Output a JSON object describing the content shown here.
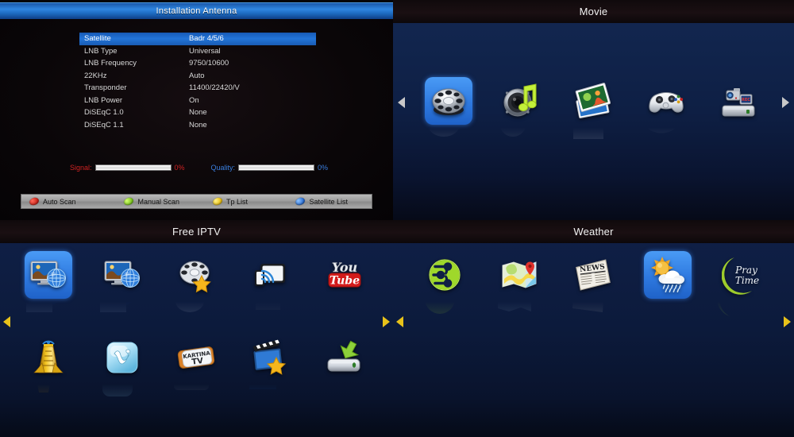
{
  "antenna": {
    "title": "Installation Antenna",
    "rows": [
      {
        "label": "Satellite",
        "value": "Badr 4/5/6",
        "selected": true
      },
      {
        "label": "LNB Type",
        "value": "Universal",
        "selected": false
      },
      {
        "label": "LNB Frequency",
        "value": "9750/10600",
        "selected": false
      },
      {
        "label": "22KHz",
        "value": "Auto",
        "selected": false
      },
      {
        "label": "Transponder",
        "value": "11400/22420/V",
        "selected": false
      },
      {
        "label": "LNB Power",
        "value": "On",
        "selected": false
      },
      {
        "label": "DiSEqC 1.0",
        "value": "None",
        "selected": false
      },
      {
        "label": "DiSEqC 1.1",
        "value": "None",
        "selected": false
      }
    ],
    "meters": {
      "signal_label": "Signal:",
      "signal_value": "0%",
      "signal_percent": 0,
      "signal_color": "#cf2222",
      "quality_label": "Quality:",
      "quality_value": "0%",
      "quality_percent": 0,
      "quality_color": "#3a7fe0"
    },
    "keys": [
      {
        "color": "red",
        "hex": "#c51b12",
        "label": "Auto Scan"
      },
      {
        "color": "green",
        "hex": "#6fbf13",
        "label": "Manual Scan"
      },
      {
        "color": "yellow",
        "hex": "#e9b903",
        "label": "Tp List"
      },
      {
        "color": "blue",
        "hex": "#1d63cf",
        "label": "Satellite List"
      }
    ]
  },
  "movie": {
    "title": "Movie",
    "arrow_left": "◀",
    "arrow_right": "▶",
    "arrow_color": "#c8c8c8",
    "items": [
      {
        "icon": "film-reel-icon",
        "selected": true
      },
      {
        "icon": "music-speaker-icon",
        "selected": false
      },
      {
        "icon": "photo-gallery-icon",
        "selected": false
      },
      {
        "icon": "game-controller-icon",
        "selected": false
      },
      {
        "icon": "camcorder-pvr-icon",
        "selected": false
      }
    ]
  },
  "iptv": {
    "title": "Free IPTV",
    "arrow_left": "◀",
    "arrow_right": "▶",
    "arrow_color": "#e8c21a",
    "row1": [
      {
        "icon": "internet-tv-icon",
        "selected": true
      },
      {
        "icon": "internet-tv-alt-icon",
        "selected": false
      },
      {
        "icon": "film-reel-star-icon",
        "selected": false
      },
      {
        "icon": "screen-cast-icon",
        "selected": false
      },
      {
        "icon": "youtube-icon",
        "selected": false,
        "text_top": "You",
        "text_bottom": "Tube"
      }
    ],
    "row2": [
      {
        "icon": "broadcast-tower-icon",
        "selected": false
      },
      {
        "icon": "vimeo-ice-icon",
        "selected": false
      },
      {
        "icon": "kartina-tv-icon",
        "selected": false,
        "text_top": "KARTINA",
        "text_bottom": "TV"
      },
      {
        "icon": "clapperboard-star-icon",
        "selected": false
      },
      {
        "icon": "download-drive-icon",
        "selected": false
      }
    ]
  },
  "weather": {
    "title": "Weather",
    "arrow_left": "◀",
    "arrow_right": "▶",
    "arrow_color": "#e8c21a",
    "items": [
      {
        "icon": "rss-network-icon",
        "selected": false
      },
      {
        "icon": "maps-icon",
        "selected": false
      },
      {
        "icon": "news-paper-icon",
        "selected": false,
        "text": "NEWS"
      },
      {
        "icon": "weather-sun-rain-icon",
        "selected": true
      },
      {
        "icon": "pray-time-icon",
        "selected": false,
        "text_top": "Pray",
        "text_bottom": "Time"
      }
    ]
  }
}
